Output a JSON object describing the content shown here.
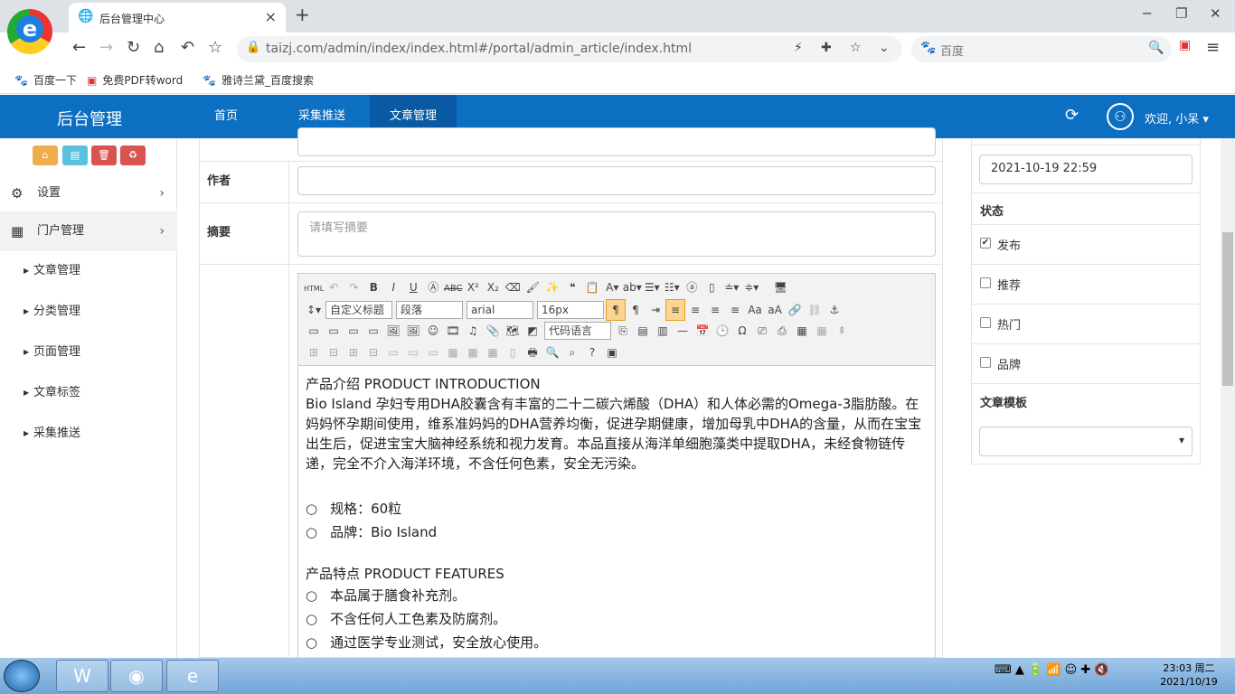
{
  "browser": {
    "tab_title": "后台管理中心",
    "url": "taizj.com/admin/index/index.html#/portal/admin_article/index.html",
    "search_placeholder": "百度"
  },
  "bookmarks": [
    "百度一下",
    "免费PDF转word",
    "雅诗兰黛_百度搜索"
  ],
  "topnav": {
    "brand": "后台管理",
    "items": [
      "首页",
      "采集推送",
      "文章管理"
    ],
    "welcome": "欢迎, 小呆 ▾"
  },
  "sidebar": {
    "buttons": {
      "colors": [
        "#f0ad4e",
        "#5bc0de",
        "#d9534f",
        "#d9534f"
      ]
    },
    "items": [
      {
        "label": "设置"
      },
      {
        "label": "门户管理"
      }
    ],
    "subitems": [
      "文章管理",
      "分类管理",
      "页面管理",
      "文章标签",
      "采集推送"
    ]
  },
  "form": {
    "author_label": "作者",
    "summary_label": "摘要",
    "summary_placeholder": "请填写摘要"
  },
  "editor": {
    "toolbar": {
      "custom_title": "自定义标题",
      "paragraph": "段落",
      "font": "arial",
      "size": "16px",
      "code_lang": "代码语言"
    },
    "body": {
      "h1": "产品介绍 PRODUCT INTRODUCTION",
      "p1": "Bio Island 孕妇专用DHA胶囊含有丰富的二十二碳六烯酸（DHA）和人体必需的Omega-3脂肪酸。在妈妈怀孕期间使用，维系准妈妈的DHA营养均衡，促进孕期健康，增加母乳中DHA的含量，从而在宝宝出生后，促进宝宝大脑神经系统和视力发育。本品直接从海洋单细胞藻类中提取DHA，未经食物链传递，完全不介入海洋环境，不含任何色素，安全无污染。",
      "spec1": "规格：60粒",
      "spec2": "品牌：Bio Island",
      "h2": "产品特点 PRODUCT FEATURES",
      "f1": "本品属于膳食补充剂。",
      "f2": "不含任何人工色素及防腐剂。",
      "f3": "通过医学专业测试，安全放心使用。"
    }
  },
  "right": {
    "date": "2021-10-19 22:59",
    "status_title": "状态",
    "checks": [
      {
        "label": "发布",
        "checked": true
      },
      {
        "label": "推荐",
        "checked": false
      },
      {
        "label": "热门",
        "checked": false
      },
      {
        "label": "品牌",
        "checked": false
      }
    ],
    "template_title": "文章模板"
  },
  "taskbar": {
    "time": "23:03 周二",
    "date": "2021/10/19"
  }
}
